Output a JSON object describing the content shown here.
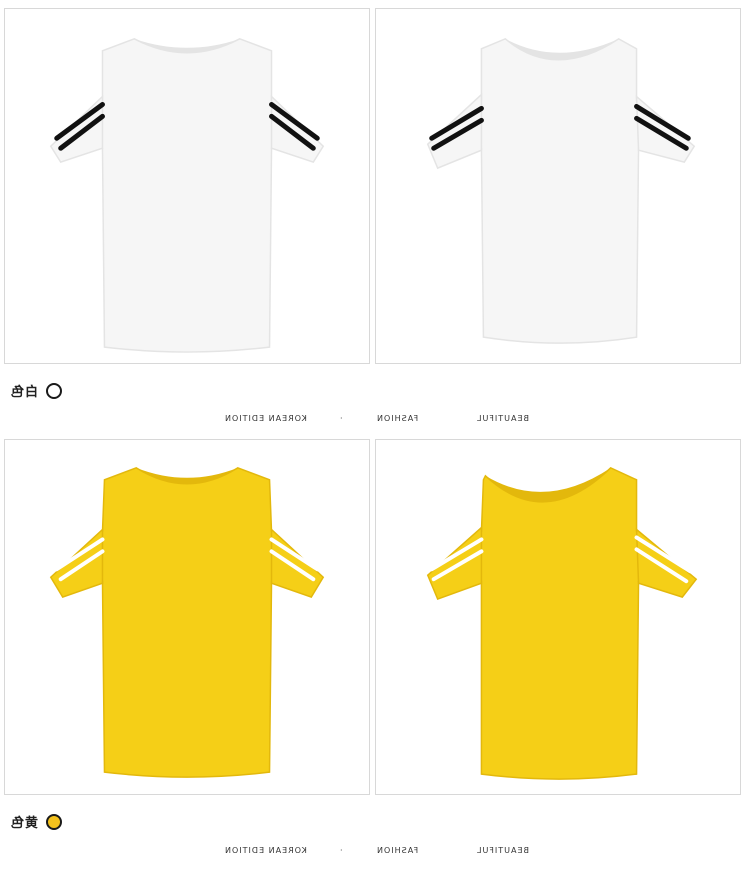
{
  "variants": [
    {
      "color_name": "白色",
      "swatch_color": "#ffffff",
      "shirt_color": "#f6f6f6",
      "shirt_shade": "#e4e4e4",
      "stripe_color": "#111111",
      "tagline": {
        "t1": "KOREAN EDITION",
        "t2": "FASHION",
        "t3": "BEAUTIFUL",
        "sep": "·"
      }
    },
    {
      "color_name": "黄色",
      "swatch_color": "#f4c21d",
      "shirt_color": "#f5cf17",
      "shirt_shade": "#e3b80c",
      "stripe_color": "#ffffff",
      "tagline": {
        "t1": "KOREAN EDITION",
        "t2": "FASHION",
        "t3": "BEAUTIFUL",
        "sep": "·"
      }
    }
  ]
}
